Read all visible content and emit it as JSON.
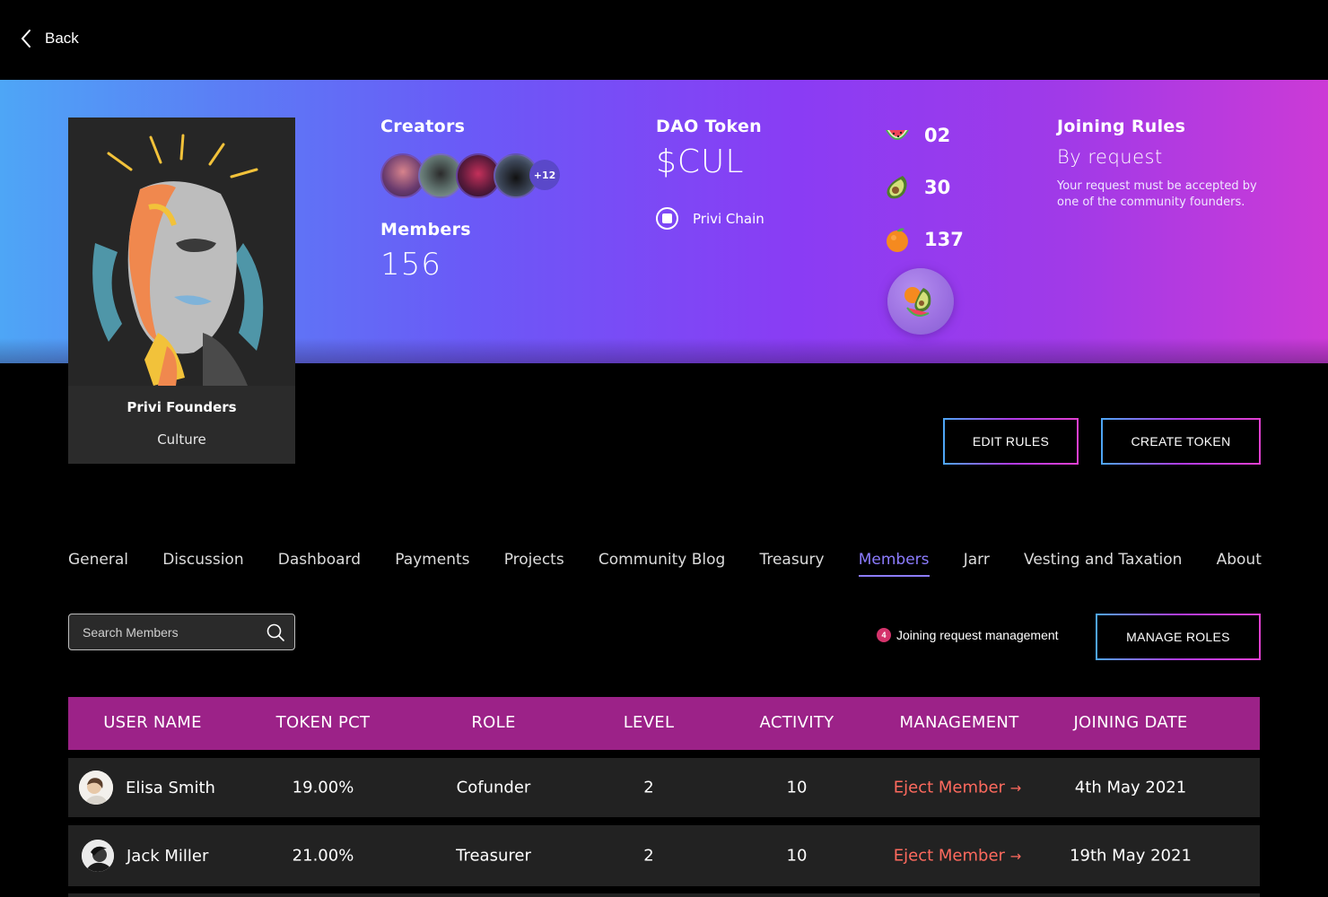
{
  "nav": {
    "back_label": "Back"
  },
  "community": {
    "name": "Privi Founders",
    "category": "Culture"
  },
  "creators": {
    "label": "Creators",
    "more_count": "+12"
  },
  "members": {
    "label": "Members",
    "count": "156"
  },
  "dao_token": {
    "label": "DAO Token",
    "symbol": "$CUL",
    "chain": "Privi Chain"
  },
  "fruits": [
    {
      "icon": "watermelon-icon",
      "count": "02"
    },
    {
      "icon": "avocado-icon",
      "count": "30"
    },
    {
      "icon": "orange-icon",
      "count": "137"
    }
  ],
  "joining_rules": {
    "label": "Joining Rules",
    "mode": "By request",
    "description": "Your request must be accepted by one of the community founders."
  },
  "actions": {
    "edit_rules": "EDIT RULES",
    "create_token": "CREATE TOKEN",
    "manage_roles": "MANAGE ROLES"
  },
  "tabs": [
    {
      "label": "General"
    },
    {
      "label": "Discussion"
    },
    {
      "label": "Dashboard"
    },
    {
      "label": "Payments"
    },
    {
      "label": "Projects"
    },
    {
      "label": "Community Blog"
    },
    {
      "label": "Treasury"
    },
    {
      "label": "Members"
    },
    {
      "label": "Jarr"
    },
    {
      "label": "Vesting and Taxation"
    },
    {
      "label": "About"
    }
  ],
  "active_tab": "Members",
  "search": {
    "placeholder": "Search Members"
  },
  "join_requests": {
    "count": "4",
    "label": "Joining request management"
  },
  "table": {
    "headers": [
      "USER NAME",
      "TOKEN PCT",
      "ROLE",
      "LEVEL",
      "ACTIVITY",
      "MANAGEMENT",
      "JOINING DATE"
    ],
    "rows": [
      {
        "name": "Elisa Smith",
        "token_pct": "19.00%",
        "role": "Cofunder",
        "level": "2",
        "activity": "10",
        "action": "Eject Member",
        "joined": "4th May 2021"
      },
      {
        "name": "Jack Miller",
        "token_pct": "21.00%",
        "role": "Treasurer",
        "level": "2",
        "activity": "10",
        "action": "Eject Member",
        "joined": "19th May 2021"
      }
    ]
  },
  "colors": {
    "header_row": "#9c2288",
    "tab_active": "#8c7cff",
    "eject": "#ff6a5e",
    "badge": "#d4336b"
  }
}
